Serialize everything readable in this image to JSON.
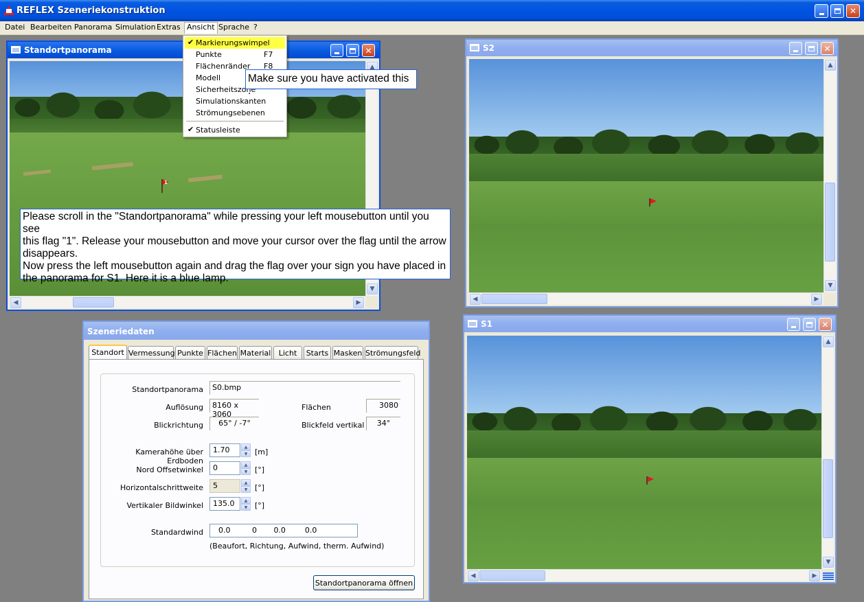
{
  "app": {
    "title": "REFLEX Szeneriekonstruktion"
  },
  "menubar": [
    "Datei",
    "Bearbeiten",
    "Panorama",
    "Simulation",
    "Extras",
    "Ansicht",
    "Sprache",
    "?"
  ],
  "ansicht_menu": [
    {
      "label": "Markierungswimpel",
      "shortcut": "",
      "checked": true
    },
    {
      "label": "Punkte",
      "shortcut": "F7",
      "checked": false
    },
    {
      "label": "Flächenränder",
      "shortcut": "F8",
      "checked": false
    },
    {
      "label": "Modell",
      "shortcut": "",
      "checked": false
    },
    {
      "label": "Sicherheitszone",
      "shortcut": "",
      "checked": false
    },
    {
      "label": "Simulationskanten",
      "shortcut": "",
      "checked": false
    },
    {
      "label": "Strömungsebenen",
      "shortcut": "",
      "checked": false
    },
    {
      "label": "Statusleiste",
      "shortcut": "",
      "checked": true
    }
  ],
  "check_glyph": "✔",
  "windows": {
    "standort": {
      "title": "Standortpanorama"
    },
    "s2": {
      "title": "S2"
    },
    "s1": {
      "title": "S1"
    },
    "szeneriedaten": {
      "title": "Szeneriedaten"
    }
  },
  "callouts": {
    "activate": "Make sure you have activated this .",
    "instructions": [
      "Please scroll in the \"Standortpanorama\" while pressing your left mousebutton until you see",
      "this flag \"1\". Release your mousebutton and move your cursor over the flag until the arrow",
      "disappears.",
      "Now press the left mousebutton again and drag the flag over your sign you have placed in",
      "the  panorama for S1. Here it is a blue lamp."
    ]
  },
  "flag_label": "1",
  "dialog": {
    "tabs": [
      "Standort",
      "Vermessung",
      "Punkte",
      "Flächen",
      "Material",
      "Licht",
      "Starts",
      "Masken",
      "Strömungsfeld"
    ],
    "active_tab": "Standort",
    "fields": {
      "standortpanorama_label": "Standortpanorama",
      "standortpanorama_value": "S0.bmp",
      "aufloesung_label": "Auflösung",
      "aufloesung_value": "8160 x 3060",
      "flaechen_label": "Flächen",
      "flaechen_value": "3080",
      "blickrichtung_label": "Blickrichtung",
      "blickrichtung_value": "65° /   -7°",
      "blickfeld_label": "Blickfeld vertikal",
      "blickfeld_value": "34°",
      "kamerahoehe_label": "Kamerahöhe über Erdboden",
      "kamerahoehe_value": "1.70",
      "kamerahoehe_unit": "[m]",
      "nord_label": "Nord Offsetwinkel",
      "nord_value": "0",
      "nord_unit": "[°]",
      "horizontal_label": "Horizontalschrittweite",
      "horizontal_value": "5",
      "horizontal_unit": "[°]",
      "vertikal_label": "Vertikaler Bildwinkel",
      "vertikal_value": "135.0",
      "vertikal_unit": "[°]",
      "standardwind_label": "Standardwind",
      "standardwind_value": "0.0         0       0.0        0.0",
      "standardwind_hint": "(Beaufort, Richtung, Aufwind, therm. Aufwind)"
    },
    "open_button": "Standortpanorama öffnen"
  },
  "colors": {
    "xp_titlebar": "#0053e1",
    "menu_highlight": "#ffff44",
    "callout_border": "#2563d6",
    "flag": "#e21b1b"
  }
}
